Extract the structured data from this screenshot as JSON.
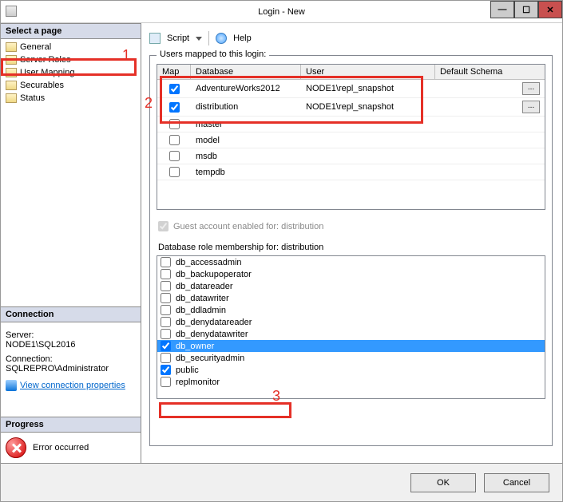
{
  "window": {
    "title": "Login - New"
  },
  "sidebar": {
    "select_page_label": "Select a page",
    "pages": [
      {
        "label": "General"
      },
      {
        "label": "Server Roles"
      },
      {
        "label": "User Mapping"
      },
      {
        "label": "Securables"
      },
      {
        "label": "Status"
      }
    ],
    "connection_label": "Connection",
    "server_label": "Server:",
    "server_value": "NODE1\\SQL2016",
    "connection_field_label": "Connection:",
    "connection_value": "SQLREPRO\\Administrator",
    "view_conn_link": "View connection properties",
    "progress_label": "Progress",
    "progress_status": "Error occurred"
  },
  "toolbar": {
    "script_label": "Script",
    "help_label": "Help"
  },
  "mapping": {
    "section_label": "Users mapped to this login:",
    "columns": {
      "map": "Map",
      "db": "Database",
      "user": "User",
      "schema": "Default Schema"
    },
    "rows": [
      {
        "checked": true,
        "db": "AdventureWorks2012",
        "user": "NODE1\\repl_snapshot",
        "dots": true
      },
      {
        "checked": true,
        "db": "distribution",
        "user": "NODE1\\repl_snapshot",
        "dots": true
      },
      {
        "checked": false,
        "db": "master",
        "user": "",
        "dots": false
      },
      {
        "checked": false,
        "db": "model",
        "user": "",
        "dots": false
      },
      {
        "checked": false,
        "db": "msdb",
        "user": "",
        "dots": false
      },
      {
        "checked": false,
        "db": "tempdb",
        "user": "",
        "dots": false
      }
    ],
    "guest_label": "Guest account enabled for: distribution",
    "roles_label": "Database role membership for: distribution",
    "roles": [
      {
        "name": "db_accessadmin",
        "checked": false,
        "selected": false
      },
      {
        "name": "db_backupoperator",
        "checked": false,
        "selected": false
      },
      {
        "name": "db_datareader",
        "checked": false,
        "selected": false
      },
      {
        "name": "db_datawriter",
        "checked": false,
        "selected": false
      },
      {
        "name": "db_ddladmin",
        "checked": false,
        "selected": false
      },
      {
        "name": "db_denydatareader",
        "checked": false,
        "selected": false
      },
      {
        "name": "db_denydatawriter",
        "checked": false,
        "selected": false
      },
      {
        "name": "db_owner",
        "checked": true,
        "selected": true
      },
      {
        "name": "db_securityadmin",
        "checked": false,
        "selected": false
      },
      {
        "name": "public",
        "checked": true,
        "selected": false
      },
      {
        "name": "replmonitor",
        "checked": false,
        "selected": false
      }
    ]
  },
  "footer": {
    "ok": "OK",
    "cancel": "Cancel"
  },
  "annotations": {
    "one": "1",
    "two": "2",
    "three": "3"
  }
}
